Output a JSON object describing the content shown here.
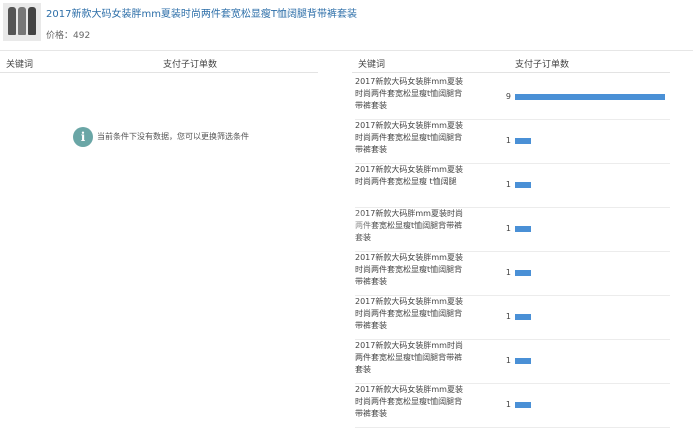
{
  "product": {
    "title": "2017新款大码女装胖mm夏装时尚两件套宽松显瘦T恤阔腿背带裤套装",
    "price_label": "价格：",
    "price_value": "492"
  },
  "left_table": {
    "col_keyword": "关键词",
    "col_orders": "支付子订单数",
    "empty_icon": "info-icon",
    "empty_text": "当前条件下没有数据，您可以更换筛选条件"
  },
  "right_table": {
    "col_keyword": "关键词",
    "col_orders": "支付子订单数",
    "bar_color": "#4a90d6",
    "max_value": 9,
    "rows": [
      {
        "keyword": "2017新款大码女装胖mm夏装时尚两件套宽松显瘦t恤阔腿背带裤套装",
        "count": "9",
        "value": 9
      },
      {
        "keyword": "2017新款大码女装胖mm夏装时尚两件套宽松显瘦t恤阔腿背带裤套装",
        "count": "1",
        "value": 1
      },
      {
        "keyword": "2017新款大码女装胖mm夏装时尚两件套宽松显瘦 t恤阔腿",
        "count": "1",
        "value": 1
      },
      {
        "keyword": "2017新款大码胖mm夏装时尚两件套宽松显瘦t恤阔腿背带裤套装",
        "count": "1",
        "value": 1
      },
      {
        "keyword": "2017新款大码女装胖mm夏装时尚两件套宽松显瘦t恤阔腿背带裤套装",
        "count": "1",
        "value": 1
      },
      {
        "keyword": "2017新款大码女装胖mm夏装时尚两件套宽松显瘦t恤阔腿背带裤套装",
        "count": "1",
        "value": 1
      },
      {
        "keyword": "2017新款大码女装胖mm时尚两件套宽松显瘦t恤阔腿背带裤套装",
        "count": "1",
        "value": 1
      },
      {
        "keyword": "2017新款大码女装胖mm夏装时尚两件套宽松显瘦t恤阔腿背带裤套装",
        "count": "1",
        "value": 1
      }
    ]
  }
}
